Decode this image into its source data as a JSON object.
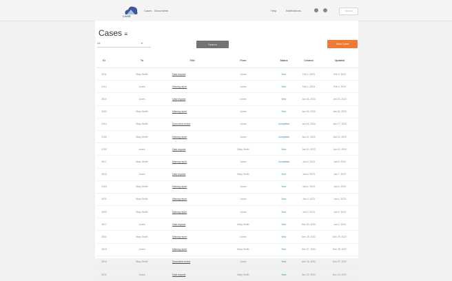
{
  "header": {
    "logo_text": "CASE",
    "links": [
      "Cases",
      "Documents"
    ],
    "right_links": [
      "Help",
      "Notifications"
    ],
    "search_placeholder": "Search"
  },
  "main": {
    "title": "Cases",
    "filter_value": "All",
    "search_button": "Search",
    "new_button": "New Case"
  },
  "table": {
    "columns": [
      "ID",
      "To",
      "Title",
      "From",
      "Status",
      "Created",
      "Updated"
    ],
    "rows": [
      [
        "3011",
        "Mary Smith",
        "Data request",
        "Jones",
        "New",
        "Feb 1, 2023",
        "Feb 3, 2023"
      ],
      [
        "3112",
        "Jones",
        "Missing report",
        "Jones",
        "New",
        "Feb 1, 2023",
        "Feb 4, 2023"
      ],
      [
        "3010",
        "Jones",
        "Data request",
        "Jones",
        "New",
        "Jan 18, 2023",
        "Jan 20, 2023"
      ],
      [
        "3002",
        "Mary Smith",
        "Missing report",
        "Jones",
        "New",
        "Jan 15, 2023",
        "Jan 16, 2023"
      ],
      [
        "3110",
        "Mary Smith",
        "Document review",
        "Jones",
        "Completed",
        "Jan 14, 2023",
        "Jan 17, 2023"
      ],
      [
        "3105",
        "Mary Smith",
        "Missing report",
        "Jones",
        "Completed",
        "Jan 11, 2023",
        "Jan 13, 2023"
      ],
      [
        "3109",
        "Jones",
        "Data request",
        "Mary Smith",
        "New",
        "Jan 10, 2023",
        "Jan 12, 2023"
      ],
      [
        "3017",
        "Mary Smith",
        "Missing report",
        "Jones",
        "Completed",
        "Jan 8, 2023",
        "Jan 9, 2023"
      ],
      [
        "3015",
        "Jones",
        "Data request",
        "Mary Smith",
        "New",
        "Jan 6, 2023",
        "Jan 7, 2023"
      ],
      [
        "3118",
        "Mary Smith",
        "Missing report",
        "Jones",
        "New",
        "Jan 4, 2023",
        "Jan 5, 2023"
      ],
      [
        "3011",
        "Mary Smith",
        "Missing report",
        "Jones",
        "New",
        "Jan 3, 2023",
        "Jan 4, 2023"
      ],
      [
        "3003",
        "Mary Smith",
        "Missing report",
        "Jones",
        "New",
        "Jan 2, 2023",
        "Jan 3, 2023"
      ],
      [
        "3017",
        "Jones",
        "Data request",
        "Mary Smith",
        "New",
        "Dec 30, 2022",
        "Jan 2, 2023"
      ],
      [
        "3002",
        "Mary Smith",
        "Missing report",
        "Jones",
        "New",
        "Dec 28, 2022",
        "Dec 29, 2022"
      ],
      [
        "3019",
        "Jones",
        "Missing report",
        "Mary Smith",
        "New",
        "Dec 27, 2022",
        "Dec 28, 2022"
      ],
      [
        "3015",
        "Mary Smith",
        "Document review",
        "Jones",
        "New",
        "Dec 26, 2022",
        "Dec 27, 2022"
      ],
      [
        "3011",
        "Jones",
        "Data request",
        "Mary Smith",
        "New",
        "Dec 22, 2022",
        "Dec 23, 2022"
      ]
    ]
  },
  "colors": {
    "accent": "#f07a35",
    "search_button": "#737373",
    "status_new": "#3ca66a",
    "status_completed": "#3c7fb6"
  }
}
